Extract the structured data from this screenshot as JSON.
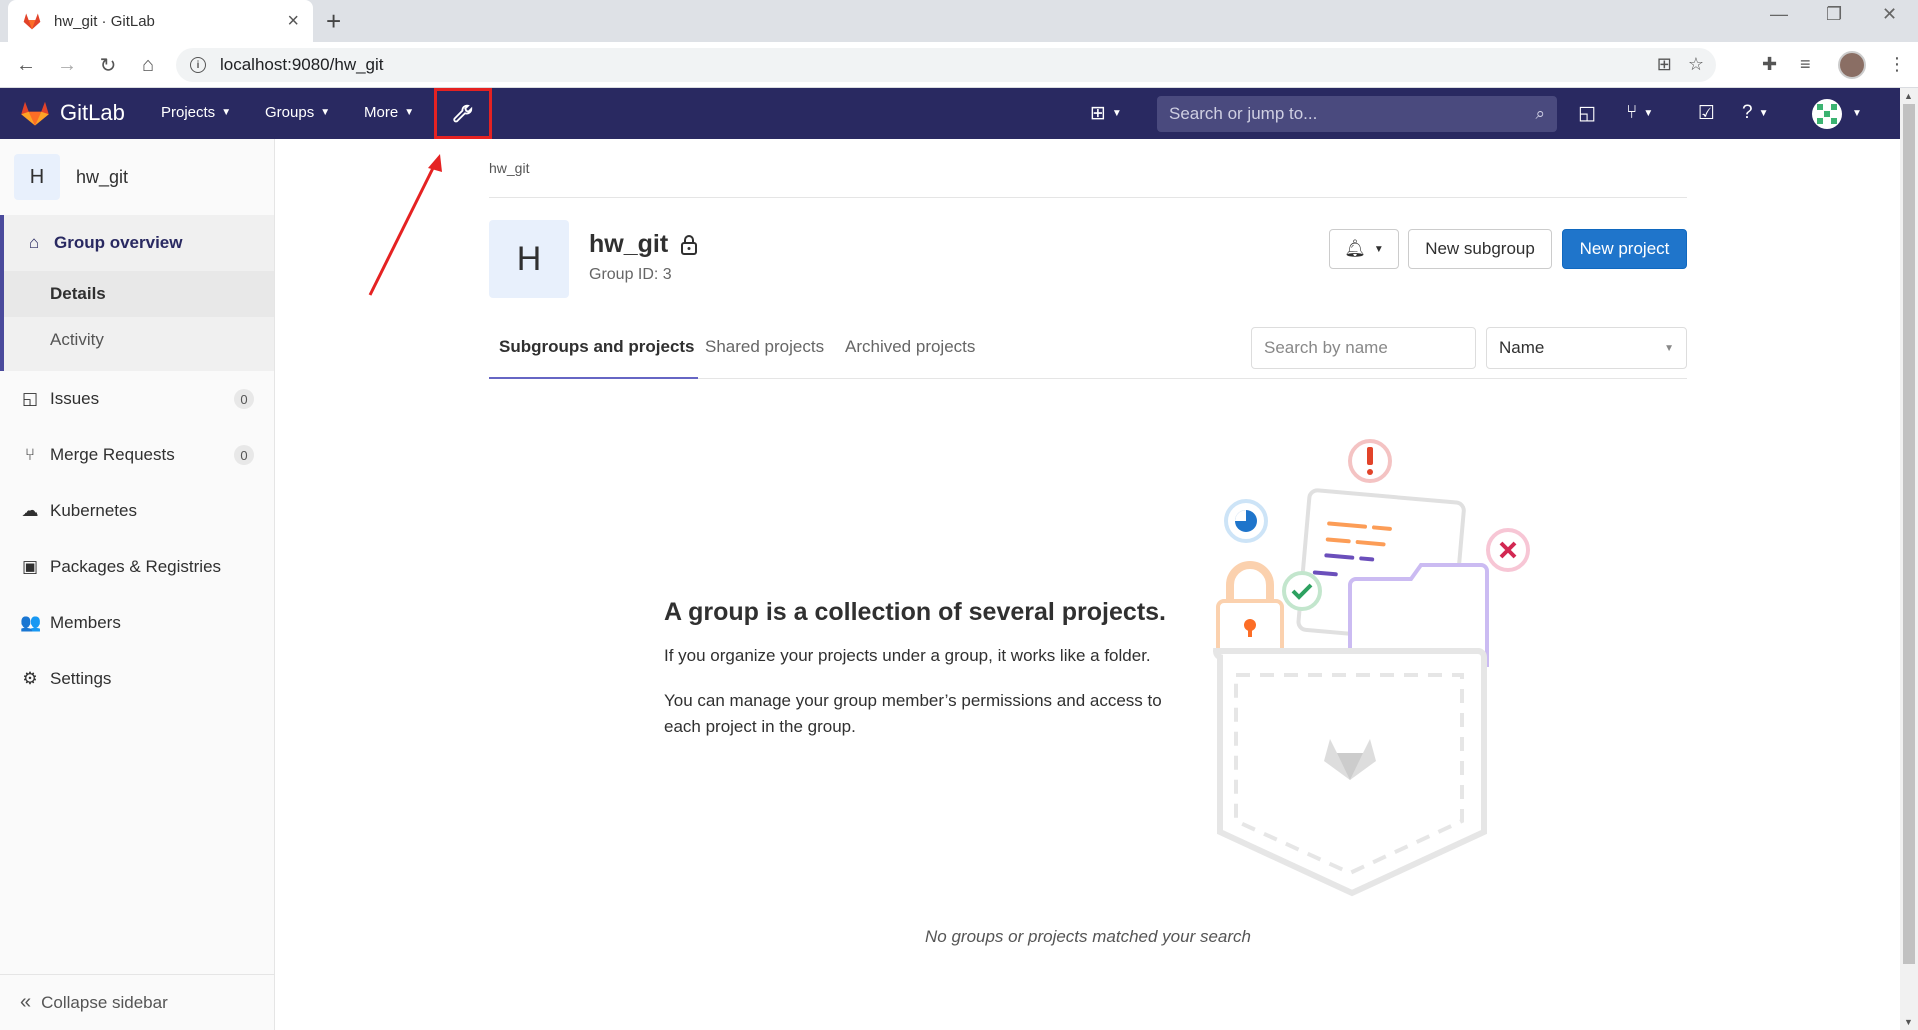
{
  "browser": {
    "tab_title": "hw_git · GitLab",
    "url": "localhost:9080/hw_git"
  },
  "header": {
    "brand": "GitLab",
    "nav": [
      {
        "label": "Projects"
      },
      {
        "label": "Groups"
      },
      {
        "label": "More"
      }
    ],
    "search_placeholder": "Search or jump to..."
  },
  "sidebar": {
    "group_initial": "H",
    "group_name": "hw_git",
    "overview_label": "Group overview",
    "sub_items": [
      {
        "label": "Details"
      },
      {
        "label": "Activity"
      }
    ],
    "items": [
      {
        "label": "Issues",
        "count": "0",
        "icon": "issues-icon"
      },
      {
        "label": "Merge Requests",
        "count": "0",
        "icon": "merge-request-icon"
      },
      {
        "label": "Kubernetes",
        "icon": "kubernetes-icon"
      },
      {
        "label": "Packages & Registries",
        "icon": "package-icon"
      },
      {
        "label": "Members",
        "icon": "members-icon"
      },
      {
        "label": "Settings",
        "icon": "settings-icon"
      }
    ],
    "collapse_label": "Collapse sidebar"
  },
  "main": {
    "breadcrumb": "hw_git",
    "group_initial": "H",
    "group_name": "hw_git",
    "group_id": "Group ID: 3",
    "buttons": {
      "new_subgroup": "New subgroup",
      "new_project": "New project"
    },
    "tabs": [
      {
        "label": "Subgroups and projects"
      },
      {
        "label": "Shared projects"
      },
      {
        "label": "Archived projects"
      }
    ],
    "search_placeholder": "Search by name",
    "sort_value": "Name",
    "empty_state": {
      "title": "A group is a collection of several projects.",
      "p1": "If you organize your projects under a group, it works like a folder.",
      "p2": "You can manage your group member’s permissions and access to each project in the group."
    },
    "no_match": "No groups or projects matched your search"
  },
  "colors": {
    "header_bg": "#292961",
    "primary_button": "#1f75cb",
    "annotation": "#e52222"
  }
}
